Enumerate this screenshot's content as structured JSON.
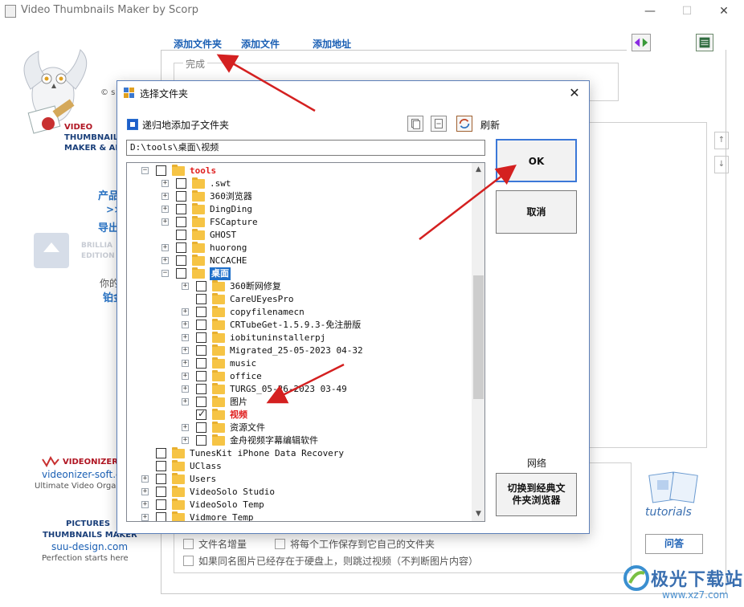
{
  "window": {
    "title": "Video Thumbnails Maker by Scorp",
    "close_glyph": "✕",
    "min_glyph": "—",
    "max_glyph": "☐"
  },
  "sidebar": {
    "copyright": "© s",
    "brand_line1": "VIDEO",
    "brand_line2": "THUMBNAILS",
    "brand_line3": "MAKER & AN",
    "product": "产品",
    "arrows": ">>",
    "export": "导出",
    "brilliant": "BRILLIA",
    "edition": "EDITION",
    "yours": "你的",
    "platinum": "铂金",
    "videonizer_name": "VIDEONIZER",
    "videonizer_url": "videonizer-soft.c",
    "videonizer_tagline": "Ultimate Video Orga",
    "pictures_line1": "PICTURES",
    "pictures_line2": "THUMBNAILS MAKER",
    "suu_url": "suu-design.com",
    "suu_tagline": "Perfection starts here"
  },
  "main": {
    "tabs": [
      {
        "label": "添加文件夹"
      },
      {
        "label": "添加文件"
      },
      {
        "label": "添加地址"
      }
    ],
    "done_label": "完成",
    "options": {
      "filename_increment": "文件名增量",
      "save_own_folder": "将每个工作保存到它自己的文件夹",
      "skip_existing": "如果同名图片已经存在于硬盘上，则跳过视频（不判断图片内容）"
    },
    "tutorials_label": "tutorials",
    "qa_label": "问答",
    "watermark_text": "极光下载站",
    "watermark_url": "www.xz7.com"
  },
  "dialog": {
    "title": "选择文件夹",
    "recursive_label": "递归地添加子文件夹",
    "recursive_checked": true,
    "refresh_label": "刷新",
    "path_value": "D:\\tools\\桌面\\视频",
    "ok_label": "OK",
    "cancel_label": "取消",
    "network_label": "网络",
    "classic_browser_line1": "切换到经典文",
    "classic_browser_line2": "件夹浏览器",
    "tree": [
      {
        "label": "tools",
        "level": 1,
        "expander": "−",
        "checked": false,
        "style": "red"
      },
      {
        "label": ".swt",
        "level": 2,
        "expander": "+",
        "checked": false,
        "style": ""
      },
      {
        "label": "360浏览器",
        "level": 2,
        "expander": "+",
        "checked": false,
        "style": ""
      },
      {
        "label": "DingDing",
        "level": 2,
        "expander": "+",
        "checked": false,
        "style": ""
      },
      {
        "label": "FSCapture",
        "level": 2,
        "expander": "+",
        "checked": false,
        "style": ""
      },
      {
        "label": "GHOST",
        "level": 2,
        "expander": "",
        "checked": false,
        "style": ""
      },
      {
        "label": "huorong",
        "level": 2,
        "expander": "+",
        "checked": false,
        "style": ""
      },
      {
        "label": "NCCACHE",
        "level": 2,
        "expander": "+",
        "checked": false,
        "style": ""
      },
      {
        "label": "桌面",
        "level": 2,
        "expander": "−",
        "checked": false,
        "style": "selected"
      },
      {
        "label": "360断网修复",
        "level": 3,
        "expander": "+",
        "checked": false,
        "style": ""
      },
      {
        "label": "CareUEyesPro",
        "level": 3,
        "expander": "",
        "checked": false,
        "style": ""
      },
      {
        "label": "copyfilenamecn",
        "level": 3,
        "expander": "+",
        "checked": false,
        "style": ""
      },
      {
        "label": "CRTubeGet-1.5.9.3-免注册版",
        "level": 3,
        "expander": "+",
        "checked": false,
        "style": ""
      },
      {
        "label": "iobituninstallerpj",
        "level": 3,
        "expander": "+",
        "checked": false,
        "style": ""
      },
      {
        "label": "Migrated_25-05-2023 04-32",
        "level": 3,
        "expander": "+",
        "checked": false,
        "style": ""
      },
      {
        "label": "music",
        "level": 3,
        "expander": "+",
        "checked": false,
        "style": ""
      },
      {
        "label": "office",
        "level": 3,
        "expander": "+",
        "checked": false,
        "style": ""
      },
      {
        "label": "TURGS_05-26-2023 03-49",
        "level": 3,
        "expander": "+",
        "checked": false,
        "style": ""
      },
      {
        "label": "图片",
        "level": 3,
        "expander": "+",
        "checked": false,
        "style": ""
      },
      {
        "label": "视频",
        "level": 3,
        "expander": "",
        "checked": true,
        "style": "red"
      },
      {
        "label": "资源文件",
        "level": 3,
        "expander": "+",
        "checked": false,
        "style": ""
      },
      {
        "label": "金舟视频字幕编辑软件",
        "level": 3,
        "expander": "+",
        "checked": false,
        "style": ""
      },
      {
        "label": "TunesKit iPhone Data Recovery",
        "level": 1,
        "expander": "",
        "checked": false,
        "style": ""
      },
      {
        "label": "UClass",
        "level": 1,
        "expander": "",
        "checked": false,
        "style": ""
      },
      {
        "label": "Users",
        "level": 1,
        "expander": "+",
        "checked": false,
        "style": ""
      },
      {
        "label": "VideoSolo Studio",
        "level": 1,
        "expander": "+",
        "checked": false,
        "style": ""
      },
      {
        "label": "VideoSolo Temp",
        "level": 1,
        "expander": "+",
        "checked": false,
        "style": ""
      },
      {
        "label": "Vidmore Temp",
        "level": 1,
        "expander": "+",
        "checked": false,
        "style": ""
      }
    ]
  },
  "colors": {
    "link_blue": "#1a5fb4",
    "folder_yellow": "#f6c445",
    "selection_blue": "#1e6fc9",
    "highlight_red": "#e02020",
    "annotation_red": "#d42020"
  }
}
